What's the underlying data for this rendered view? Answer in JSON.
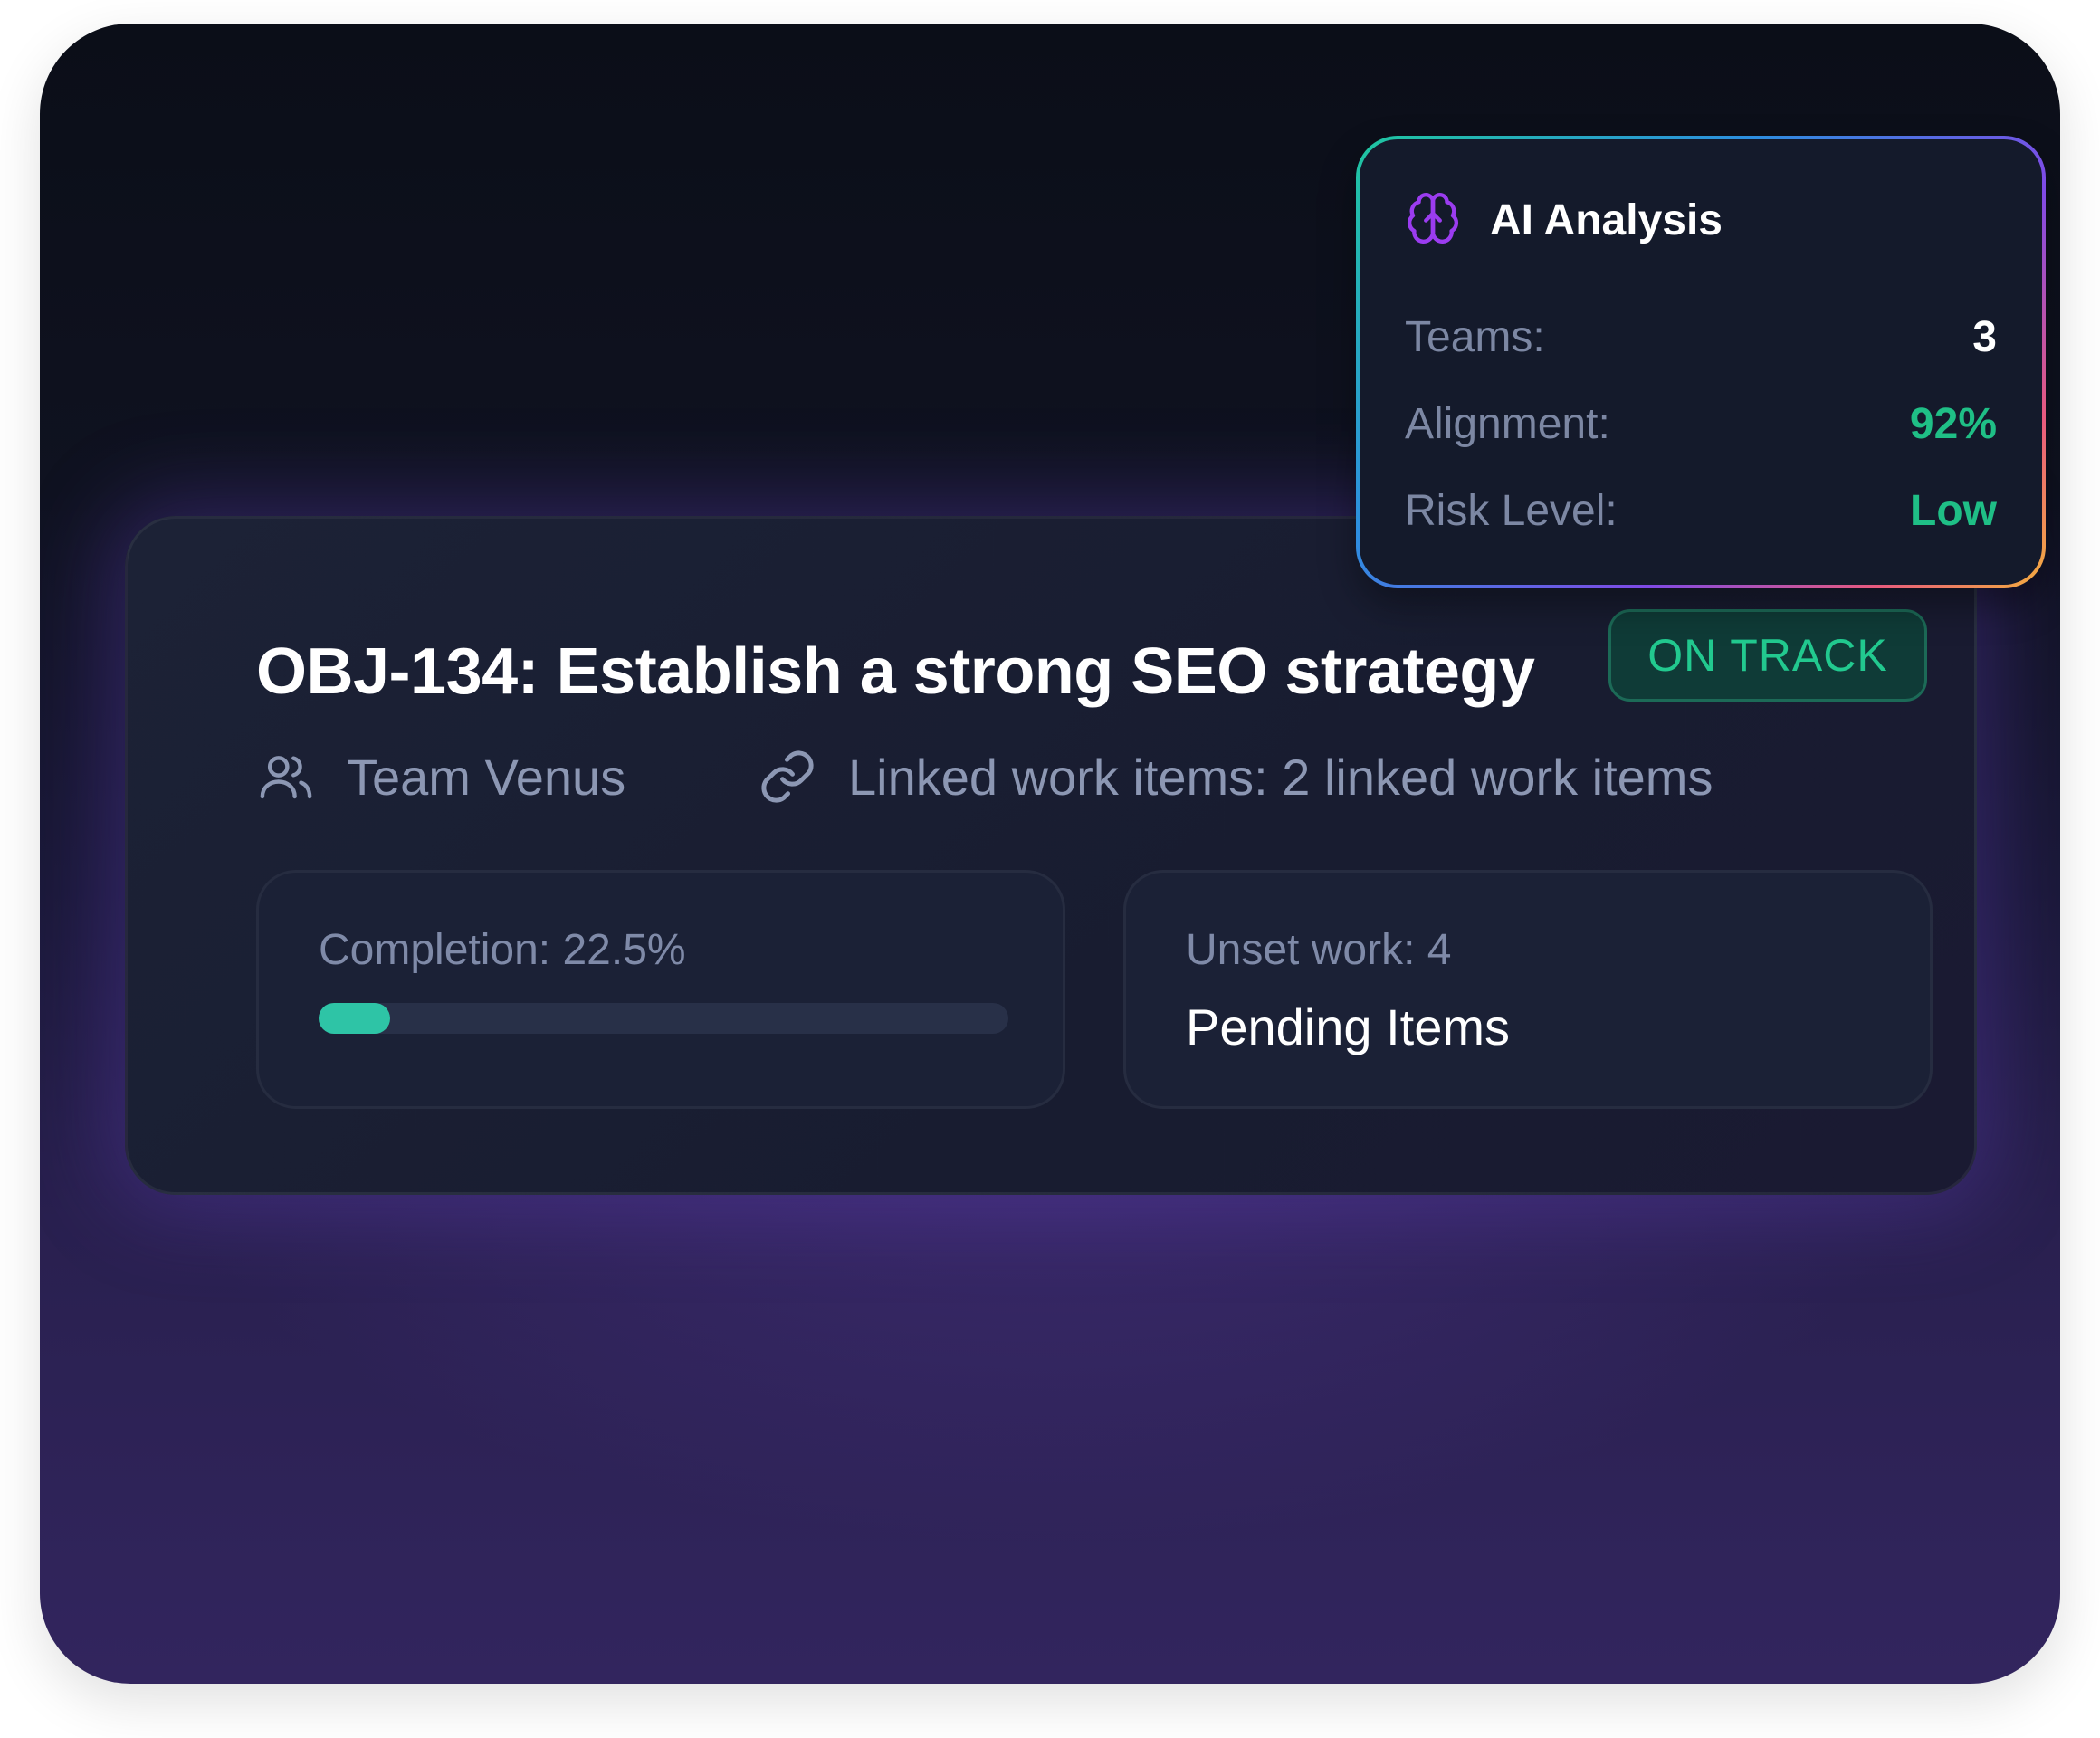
{
  "objective": {
    "title": "OBJ-134: Establish a strong SEO strategy",
    "status": "ON TRACK",
    "team": "Team Venus",
    "linked_items": "Linked work items: 2 linked work items"
  },
  "stats": {
    "completion_label": "Completion: 22.5%",
    "completion_fraction": 0.225,
    "unset_label": "Unset work: 4",
    "pending_label": "Pending Items"
  },
  "ai_analysis": {
    "title": "AI Analysis",
    "icon": "brain-icon",
    "rows": [
      {
        "key": "Teams:",
        "value": "3"
      },
      {
        "key": "Alignment:",
        "value": "92%"
      },
      {
        "key": "Risk Level:",
        "value": "Low"
      }
    ]
  },
  "colors": {
    "accent_green": "#1fbf86",
    "progress": "#2ec4a6",
    "brain_icon": "#9b3cf0"
  }
}
